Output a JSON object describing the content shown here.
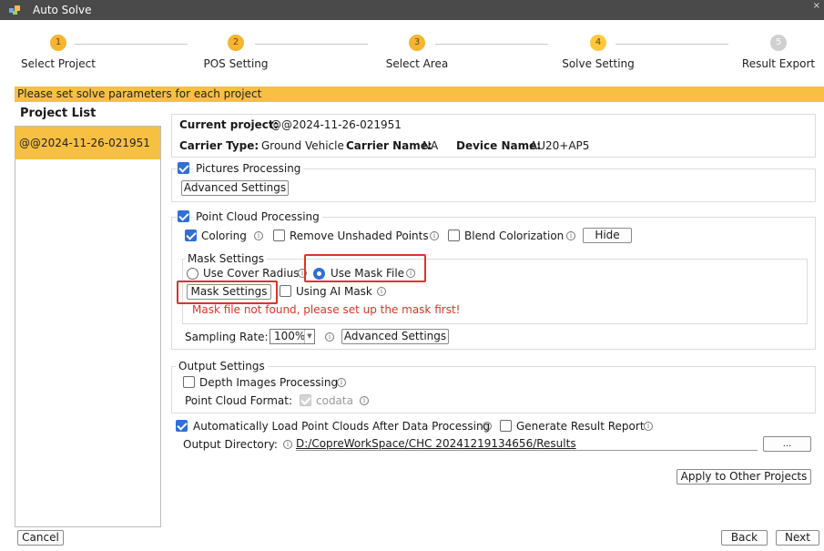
{
  "window": {
    "title": "Auto Solve",
    "close_glyph": "×"
  },
  "steps": [
    {
      "num": "1",
      "label": "Select Project",
      "state": "done"
    },
    {
      "num": "2",
      "label": "POS Setting",
      "state": "done"
    },
    {
      "num": "3",
      "label": "Select Area",
      "state": "done"
    },
    {
      "num": "4",
      "label": "Solve Setting",
      "state": "current"
    },
    {
      "num": "5",
      "label": "Result Export",
      "state": "pending"
    }
  ],
  "banner": "Please set solve parameters for each project",
  "project_list": {
    "title": "Project List",
    "items": [
      "@@2024-11-26-021951"
    ]
  },
  "current": {
    "project_label": "Current project:",
    "project_value": "@@2024-11-26-021951",
    "carrier_type_label": "Carrier Type:",
    "carrier_type_value": "Ground Vehicle",
    "carrier_name_label": "Carrier Name:",
    "carrier_name_value": "NA",
    "device_name_label": "Device Name:",
    "device_name_value": "AU20+AP5"
  },
  "pictures": {
    "label": "Pictures Processing",
    "checked": true,
    "advanced": "Advanced Settings"
  },
  "point_cloud": {
    "label": "Point Cloud Processing",
    "checked": true,
    "coloring": "Coloring",
    "coloring_checked": true,
    "remove_unshaded": "Remove Unshaded Points",
    "remove_unshaded_checked": false,
    "blend": "Blend Colorization",
    "blend_checked": false,
    "hide": "Hide",
    "mask": {
      "title": "Mask Settings",
      "use_cover_radius": "Use Cover Radius",
      "use_mask_file": "Use Mask File",
      "selected": "use_mask_file",
      "mask_settings_button": "Mask Settings",
      "using_ai_mask": "Using AI Mask",
      "error": "Mask file not found, please set up the mask first!"
    },
    "sampling_label": "Sampling Rate:",
    "sampling_value": "100%",
    "advanced": "Advanced Settings"
  },
  "output": {
    "title": "Output Settings",
    "depth_images": "Depth Images Processing",
    "depth_checked": false,
    "format_label": "Point Cloud Format:",
    "format_value": "codata"
  },
  "auto_load": {
    "label": "Automatically Load Point Clouds After Data Processing",
    "checked": true
  },
  "gen_report": {
    "label": "Generate Result Report",
    "checked": false
  },
  "output_dir": {
    "label": "Output Directory:",
    "value": "D:/CopreWorkSpace/CHC 20241219134656/Results",
    "browse": "..."
  },
  "buttons": {
    "apply": "Apply to Other Projects",
    "cancel": "Cancel",
    "back": "Back",
    "next": "Next"
  },
  "info_glyph": "i",
  "colors": {
    "accent": "#f7c042",
    "primary": "#2f6fd6",
    "error": "#e0322a"
  }
}
